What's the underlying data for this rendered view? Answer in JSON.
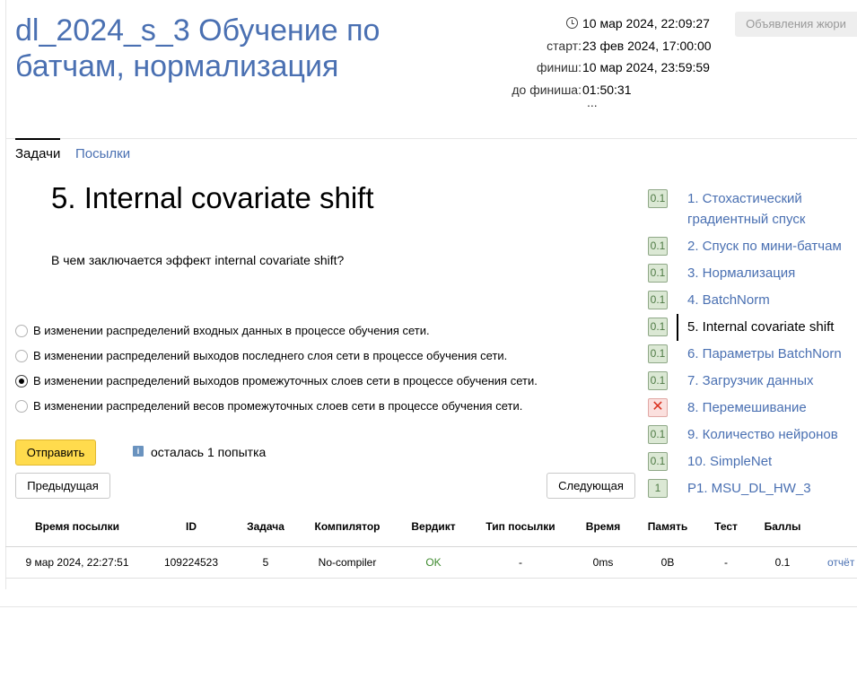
{
  "contest": {
    "title": "dl_2024_s_3 Обучение по батчам, нормализация"
  },
  "timing": {
    "now": "10 мар 2024, 22:09:27",
    "start_label": "старт:",
    "start": "23 фев 2024, 17:00:00",
    "finish_label": "финиш:",
    "finish": "10 мар 2024, 23:59:59",
    "remaining_label": "до финиша:",
    "remaining": "01:50:31",
    "more": "..."
  },
  "header": {
    "jury_button": "Объявления жюри"
  },
  "tabs": [
    {
      "label": "Задачи",
      "active": true
    },
    {
      "label": "Посылки",
      "active": false
    }
  ],
  "problem": {
    "title": "5. Internal covariate shift",
    "statement": "В чем заключается эффект internal covariate shift?",
    "options": [
      {
        "text": "В изменении распределений входных данных в процессе обучения сети.",
        "checked": false
      },
      {
        "text": "В изменении распределений выходов последнего слоя сети в процессе обучения сети.",
        "checked": false
      },
      {
        "text": "В изменении распределений выходов промежуточных слоев сети в процессе обучения сети.",
        "checked": true
      },
      {
        "text": "В изменении распределений весов промежуточных слоев сети в процессе обучения сети.",
        "checked": false
      }
    ],
    "submit_label": "Отправить",
    "info_icon": "i",
    "attempts": "осталась 1 попытка",
    "prev_label": "Предыдущая",
    "next_label": "Следующая"
  },
  "sidebar": {
    "items": [
      {
        "badge": "0.1",
        "status": "ok",
        "label_lines": [
          "1. Стохастический",
          "градиентный спуск"
        ],
        "active": false
      },
      {
        "badge": "0.1",
        "status": "ok",
        "label_lines": [
          "2. Спуск по мини-батчам"
        ],
        "active": false
      },
      {
        "badge": "0.1",
        "status": "ok",
        "label_lines": [
          "3. Нормализация"
        ],
        "active": false
      },
      {
        "badge": "0.1",
        "status": "ok",
        "label_lines": [
          "4. BatchNorm"
        ],
        "active": false
      },
      {
        "badge": "0.1",
        "status": "ok",
        "label_lines": [
          "5. Internal covariate shift"
        ],
        "active": true
      },
      {
        "badge": "0.1",
        "status": "ok",
        "label_lines": [
          "6. Параметры BatchNorn"
        ],
        "active": false
      },
      {
        "badge": "0.1",
        "status": "ok",
        "label_lines": [
          "7. Загрузчик данных"
        ],
        "active": false
      },
      {
        "badge": "✕",
        "status": "fail",
        "label_lines": [
          "8. Перемешивание"
        ],
        "active": false
      },
      {
        "badge": "0.1",
        "status": "ok",
        "label_lines": [
          "9. Количество нейронов"
        ],
        "active": false
      },
      {
        "badge": "0.1",
        "status": "ok",
        "label_lines": [
          "10. SimpleNet"
        ],
        "active": false
      },
      {
        "badge": "1",
        "status": "ok",
        "label_lines": [
          "P1. MSU_DL_HW_3"
        ],
        "active": false
      }
    ]
  },
  "submissions": {
    "columns": [
      "Время посылки",
      "ID",
      "Задача",
      "Компилятор",
      "Вердикт",
      "Тип посылки",
      "Время",
      "Память",
      "Тест",
      "Баллы"
    ],
    "rows": [
      {
        "time": "9 мар 2024, 22:27:51",
        "id": "109224523",
        "task": "5",
        "compiler": "No-compiler",
        "verdict": "OK",
        "type": "-",
        "run_time": "0ms",
        "memory": "0B",
        "test": "-",
        "score": "0.1",
        "report": "отчёт"
      }
    ]
  },
  "colors": {
    "link": "#4a70b2",
    "submit": "#ffdb4d",
    "ok": "#3f8b2f",
    "fail": "#d9301e"
  }
}
